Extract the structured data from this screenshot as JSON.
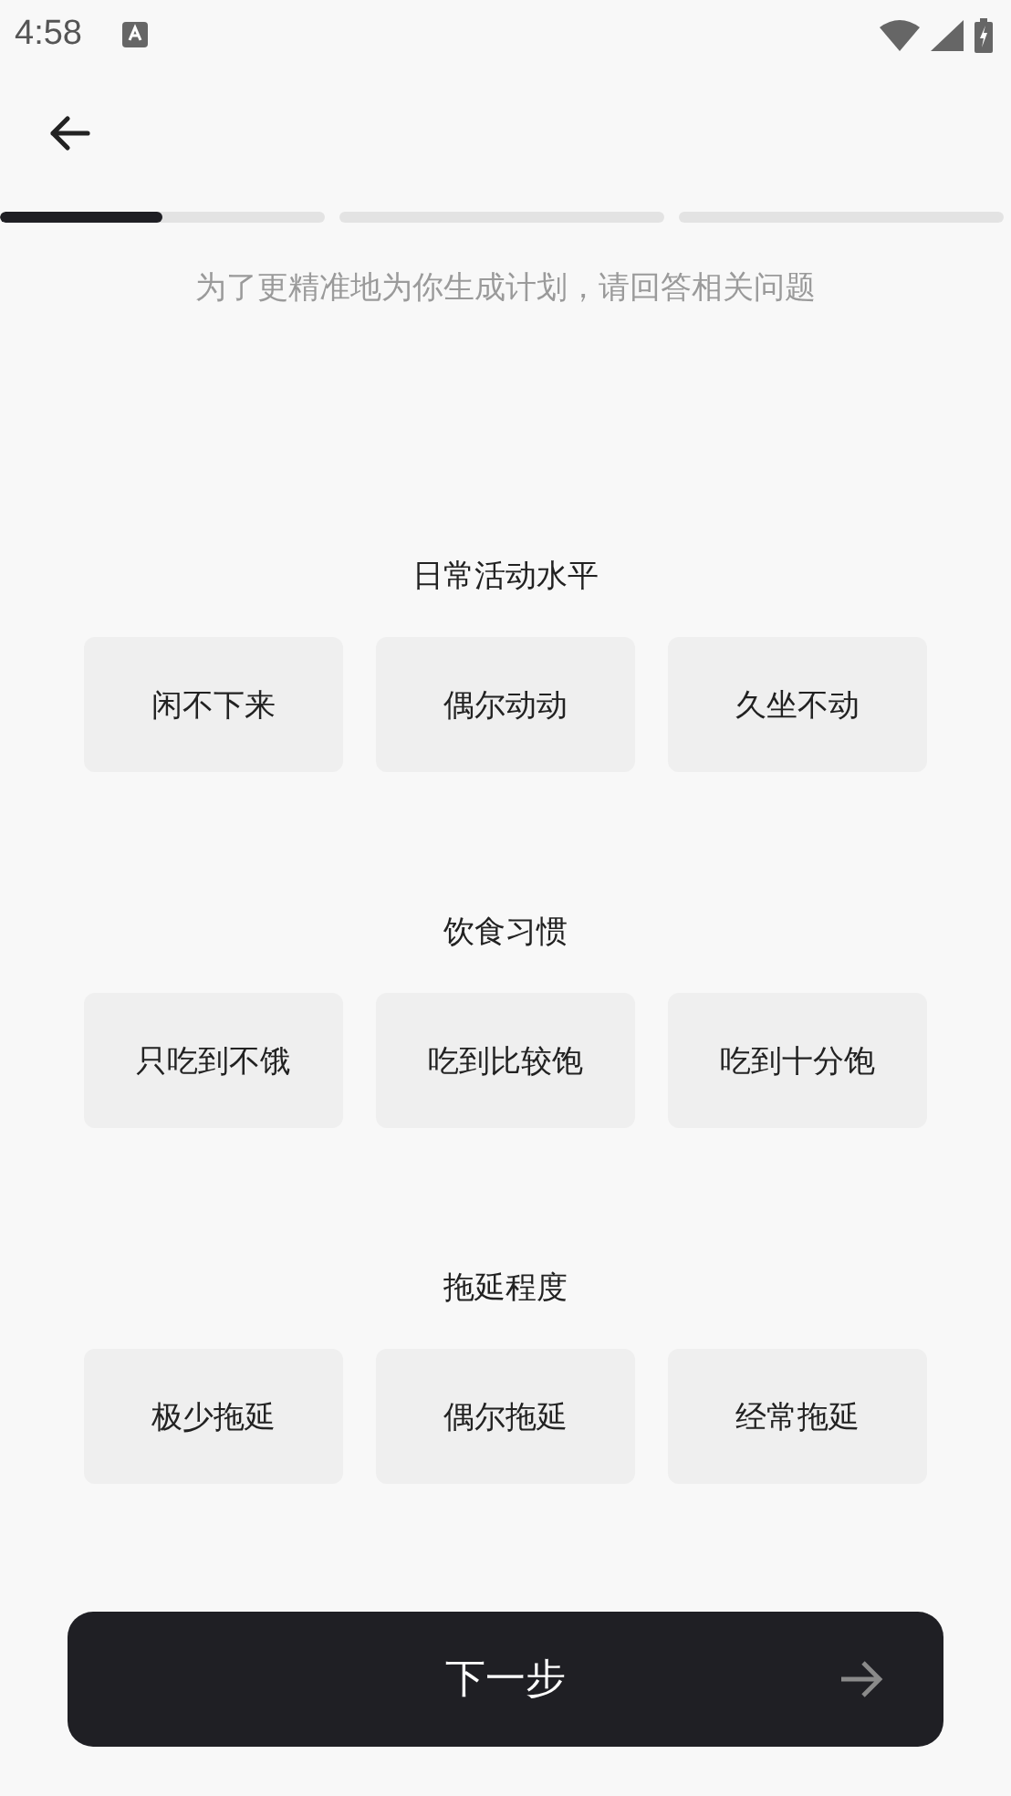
{
  "status_bar": {
    "time": "4:58"
  },
  "progress": [
    {
      "level": 0.5
    },
    {
      "level": 0
    },
    {
      "level": 0
    }
  ],
  "subtitle": "为了更精准地为你生成计划，请回答相关问题",
  "questions": [
    {
      "title": "日常活动水平",
      "options": [
        {
          "label": "闲不下来",
          "selected": false
        },
        {
          "label": "偶尔动动",
          "selected": false
        },
        {
          "label": "久坐不动",
          "selected": false
        }
      ]
    },
    {
      "title": "饮食习惯",
      "options": [
        {
          "label": "只吃到不饿",
          "selected": false
        },
        {
          "label": "吃到比较饱",
          "selected": false
        },
        {
          "label": "吃到十分饱",
          "selected": false
        }
      ]
    },
    {
      "title": "拖延程度",
      "options": [
        {
          "label": "极少拖延",
          "selected": false
        },
        {
          "label": "偶尔拖延",
          "selected": false
        },
        {
          "label": "经常拖延",
          "selected": false
        }
      ]
    }
  ],
  "next_button": {
    "label": "下一步"
  }
}
